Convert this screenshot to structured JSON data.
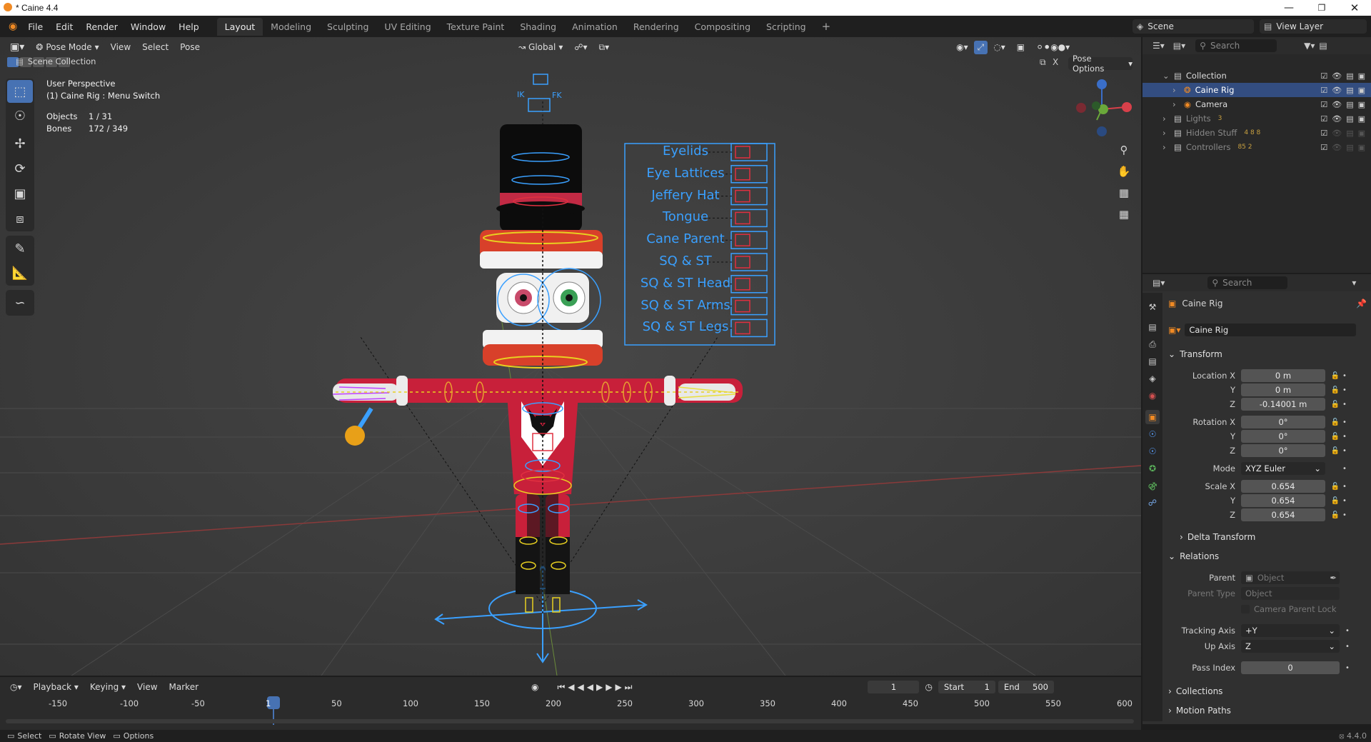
{
  "window": {
    "title": "* Caine 4.4"
  },
  "menu": {
    "items": [
      "File",
      "Edit",
      "Render",
      "Window",
      "Help"
    ],
    "workspaces": [
      "Layout",
      "Modeling",
      "Sculpting",
      "UV Editing",
      "Texture Paint",
      "Shading",
      "Animation",
      "Rendering",
      "Compositing",
      "Scripting"
    ],
    "scene": "Scene",
    "view_layer": "View Layer"
  },
  "viewport_header": {
    "mode": "Pose Mode",
    "view": "View",
    "select": "Select",
    "pose": "Pose",
    "orientation": "Global",
    "pose_options": "Pose Options"
  },
  "viewport_info": {
    "perspective": "User Perspective",
    "context": "(1) Caine Rig : Menu Switch",
    "objects_label": "Objects",
    "objects_value": "1 / 31",
    "bones_label": "Bones",
    "bones_value": "172 / 349"
  },
  "rig_menu": {
    "items": [
      "Eyelids",
      "Eye Lattices",
      "Jeffery Hat",
      "Tongue",
      "Cane Parent",
      "SQ & ST",
      "SQ & ST Head",
      "SQ & ST Arms",
      "SQ & ST Legs"
    ],
    "ik_label": "IK",
    "fk_label": "FK"
  },
  "outliner": {
    "search_placeholder": "Search",
    "scene_collection": "Scene Collection",
    "rows": [
      {
        "label": "Collection",
        "indent": 1
      },
      {
        "label": "Caine Rig",
        "indent": 2,
        "selected": true
      },
      {
        "label": "Camera",
        "indent": 2
      },
      {
        "label": "Lights",
        "indent": 1,
        "badge": "3"
      },
      {
        "label": "Hidden Stuff",
        "indent": 1,
        "badge": "4 8 8"
      },
      {
        "label": "Controllers",
        "indent": 1,
        "badge": "85 2"
      }
    ]
  },
  "properties": {
    "search_placeholder": "Search",
    "object_name": "Caine Rig",
    "data_name": "Caine Rig",
    "transform": {
      "title": "Transform",
      "location_label": "Location X",
      "location": [
        "0 m",
        "0 m",
        "-0.14001 m"
      ],
      "rotation_label": "Rotation X",
      "rotation": [
        "0°",
        "0°",
        "0°"
      ],
      "mode_label": "Mode",
      "mode": "XYZ Euler",
      "scale_label": "Scale X",
      "scale": [
        "0.654",
        "0.654",
        "0.654"
      ],
      "y": "Y",
      "z": "Z"
    },
    "delta_transform": "Delta Transform",
    "relations": {
      "title": "Relations",
      "parent_label": "Parent",
      "parent_placeholder": "Object",
      "parent_type_label": "Parent Type",
      "parent_type": "Object",
      "camera_parent_lock": "Camera Parent Lock",
      "tracking_axis_label": "Tracking Axis",
      "tracking_axis": "+Y",
      "up_axis_label": "Up Axis",
      "up_axis": "Z",
      "pass_index_label": "Pass Index",
      "pass_index": "0"
    },
    "collections": "Collections",
    "motion_paths": "Motion Paths"
  },
  "timeline": {
    "playback": "Playback",
    "keying": "Keying",
    "view": "View",
    "marker": "Marker",
    "current_frame": "1",
    "start_label": "Start",
    "start": "1",
    "end_label": "End",
    "end": "500",
    "ticks": [
      "-150",
      "-100",
      "-50",
      "1",
      "50",
      "100",
      "150",
      "200",
      "250",
      "300",
      "350",
      "400",
      "450",
      "500",
      "550",
      "600"
    ]
  },
  "statusbar": {
    "select": "Select",
    "rotate_view": "Rotate View",
    "options": "Options",
    "version": "4.4.0"
  },
  "colors": {
    "accent": "#4772b3",
    "rig_menu_text": "#3aa0ff",
    "viewport_bg": "#3d3d3d",
    "selected_row": "#334d80"
  }
}
